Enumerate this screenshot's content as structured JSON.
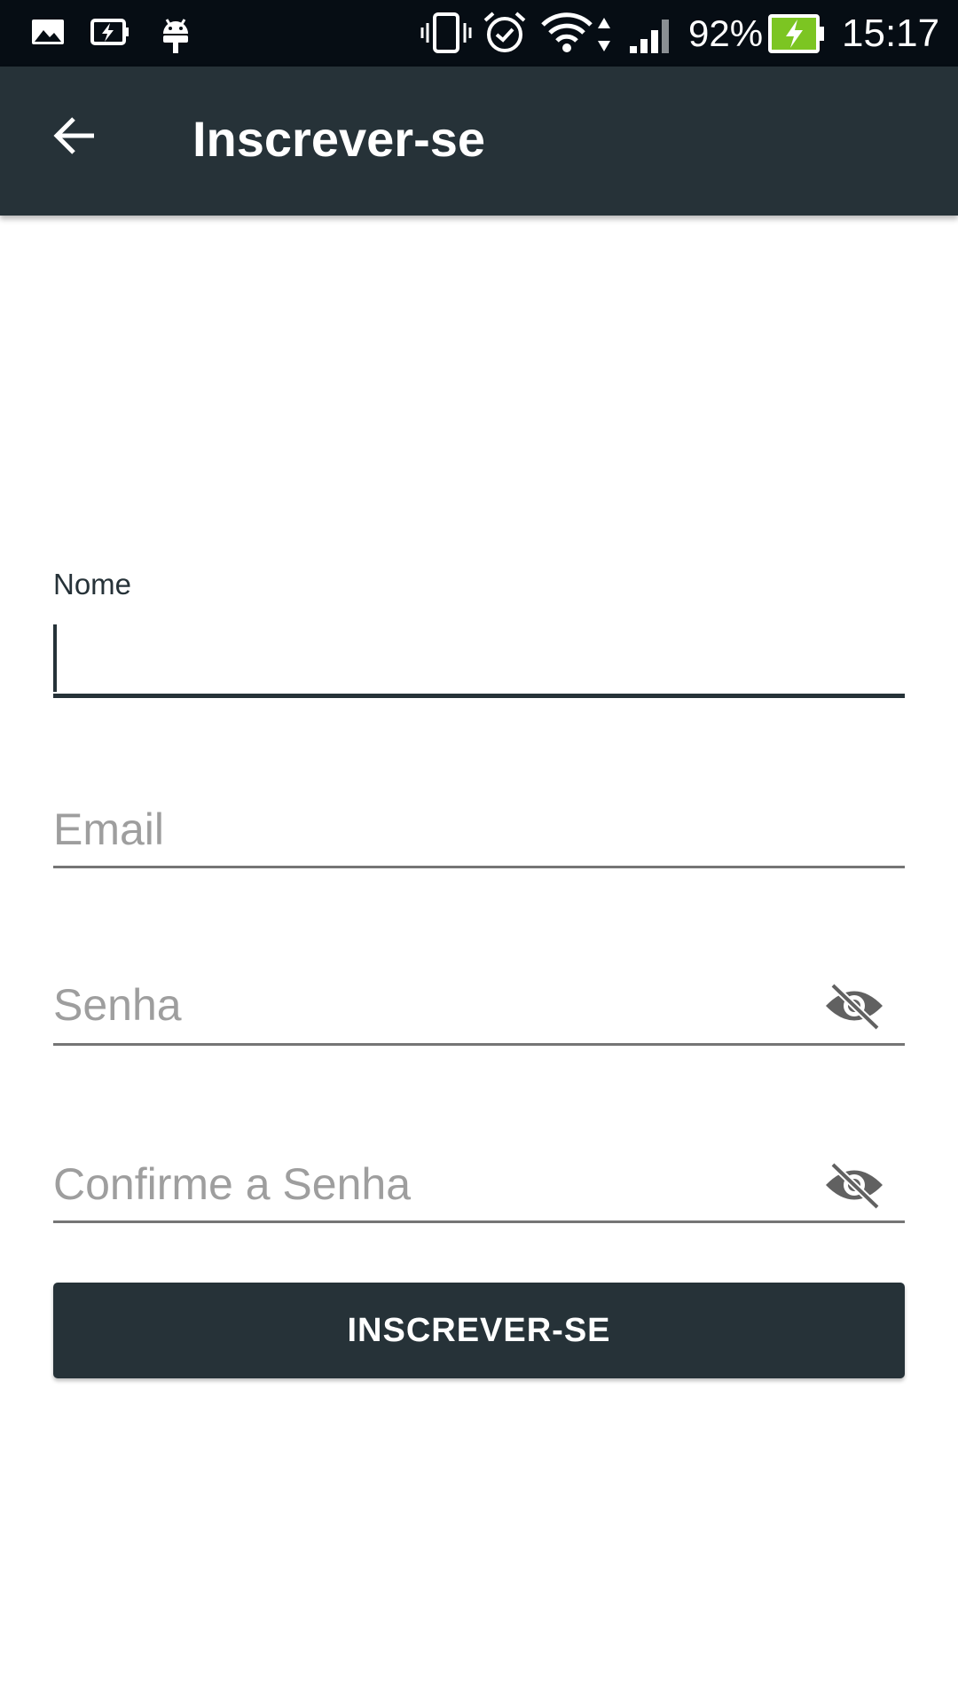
{
  "status_bar": {
    "icons": [
      "photo-notification-icon",
      "battery-charging-notification-icon",
      "android-debug-icon",
      "vibrate-icon",
      "alarm-icon",
      "wifi-icon",
      "data-arrows-icon",
      "signal-icon",
      "battery-icon"
    ],
    "battery_percent": "92%",
    "time": "15:17",
    "battery_fill_color": "#7cc522"
  },
  "app_bar": {
    "title": "Inscrever-se",
    "back_icon": "arrow-left-icon",
    "background": "#263238"
  },
  "form": {
    "name": {
      "label": "Nome",
      "value": "",
      "focused": true
    },
    "email": {
      "placeholder": "Email",
      "value": ""
    },
    "password": {
      "placeholder": "Senha",
      "value": "",
      "toggle_icon": "eye-off-icon"
    },
    "confirm_password": {
      "placeholder": "Confirme a Senha",
      "value": "",
      "toggle_icon": "eye-off-icon"
    },
    "submit_label": "INSCREVER-SE"
  },
  "colors": {
    "primary": "#263238",
    "status_bar": "#060d14",
    "placeholder": "#9e9e9e"
  }
}
